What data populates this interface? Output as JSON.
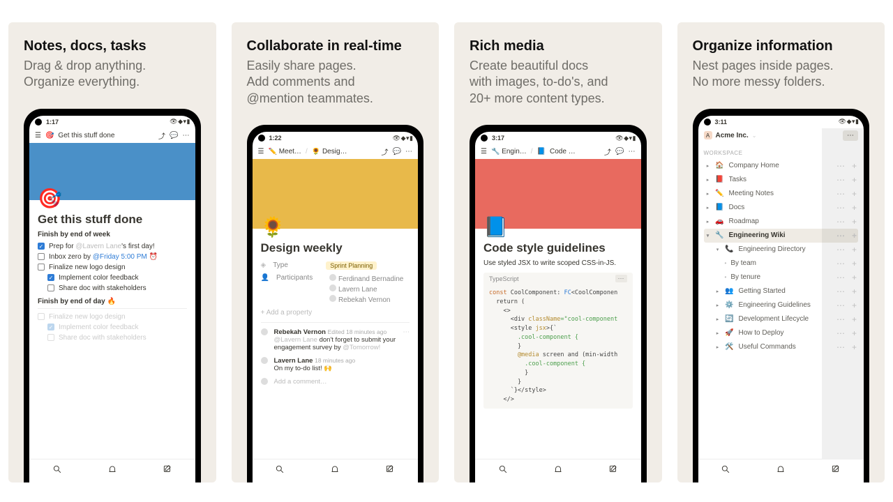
{
  "panels": [
    {
      "title": "Notes, docs, tasks",
      "sub": "Drag & drop anything.\nOrganize everything."
    },
    {
      "title": "Collaborate in real-time",
      "sub": "Easily share pages.\nAdd comments and\n@mention teammates."
    },
    {
      "title": "Rich media",
      "sub": "Create beautiful docs\nwith images, to-do's, and\n20+ more content types."
    },
    {
      "title": "Organize information",
      "sub": "Nest pages inside pages.\nNo more messy folders."
    }
  ],
  "p1": {
    "time": "1:17",
    "crumb_icon": "🎯",
    "crumb": "Get this stuff done",
    "cover_color": "#4a90c8",
    "emoji": "🎯",
    "page_title": "Get this stuff done",
    "section1": "Finish by end of week",
    "task1_pre": "Prep for ",
    "task1_mention": "@Lavern Lane",
    "task1_post": "'s first day!",
    "task2_pre": "Inbox zero by ",
    "task2_tag": "@Friday 5:00 PM ⏰",
    "task3": "Finalize new logo design",
    "task3a": "Implement color feedback",
    "task3b": "Share doc with stakeholders",
    "section2": "Finish by end of day 🔥",
    "ghost1": "Finalize new logo design",
    "ghost2": "Implement color feedback",
    "ghost3": "Share doc with stakeholders"
  },
  "p2": {
    "time": "1:22",
    "crumb1": "✏️ Meet…",
    "crumb2": "🌻 Desig…",
    "cover_color": "#e8b94a",
    "emoji": "🌻",
    "page_title": "Design weekly",
    "prop_type": "Type",
    "prop_type_value": "Sprint Planning",
    "prop_participants": "Participants",
    "participants": [
      "Ferdinand Bernadine",
      "Lavern Lane",
      "Rebekah Vernon"
    ],
    "add_prop": "+  Add a property",
    "comment1_name": "Rebekah Vernon",
    "comment1_meta": "Edited 18 minutes ago",
    "comment1_text_pre": "@Lavern Lane ",
    "comment1_text_mid": "don't forget to submit your engagement survey by ",
    "comment1_text_tag": "@Tomorrow!",
    "comment2_name": "Lavern Lane",
    "comment2_meta": "18 minutes ago",
    "comment2_text": "On my to-do list! 🙌",
    "add_comment": "Add a comment…"
  },
  "p3": {
    "time": "3:17",
    "crumb1": "🔧 Engin…",
    "crumb2_icon": "📘",
    "crumb2": "Code …",
    "cover_color": "#e86a5f",
    "emoji": "📘",
    "page_title": "Code style guidelines",
    "intro": "Use styled JSX to write scoped CSS-in-JS.",
    "lang": "TypeScript",
    "code_l1a": "const",
    "code_l1b": " CoolComponent: ",
    "code_l1c": "FC",
    "code_l1d": "<CoolComponen",
    "code_l2": "  return (",
    "code_l3": "    <>",
    "code_l4a": "      <div ",
    "code_l4b": "className",
    "code_l4c": "=\"cool-component",
    "code_l5a": "      <style ",
    "code_l5b": "jsx",
    "code_l5c": ">{`",
    "code_l6": "        .cool-component {",
    "code_l7": "        }",
    "code_l8a": "        @media",
    "code_l8b": " screen and (min-width",
    "code_l9": "          .cool-component {",
    "code_l10": "          }",
    "code_l11": "        }",
    "code_l12": "      `}</style>",
    "code_l13": "    </>"
  },
  "p4": {
    "time": "3:11",
    "workspace": "Acme Inc.",
    "ws_label": "WORKSPACE",
    "items": [
      {
        "icon": "🏠",
        "label": "Company Home"
      },
      {
        "icon": "📕",
        "label": "Tasks"
      },
      {
        "icon": "✏️",
        "label": "Meeting Notes"
      },
      {
        "icon": "📘",
        "label": "Docs"
      },
      {
        "icon": "🚗",
        "label": "Roadmap"
      },
      {
        "icon": "🔧",
        "label": "Engineering Wiki",
        "selected": true,
        "expanded": true
      },
      {
        "icon": "📞",
        "label": "Engineering Directory",
        "indent": 1,
        "expanded": true
      },
      {
        "label": "By team",
        "indent": 2,
        "bullet": true
      },
      {
        "label": "By tenure",
        "indent": 2,
        "bullet": true
      },
      {
        "icon": "👥",
        "label": "Getting Started",
        "indent": 1
      },
      {
        "icon": "⚙️",
        "label": "Engineering Guidelines",
        "indent": 1
      },
      {
        "icon": "🔄",
        "label": "Development Lifecycle",
        "indent": 1
      },
      {
        "icon": "🚀",
        "label": "How to Deploy",
        "indent": 1
      },
      {
        "icon": "🛠️",
        "label": "Useful Commands",
        "indent": 1
      }
    ]
  }
}
